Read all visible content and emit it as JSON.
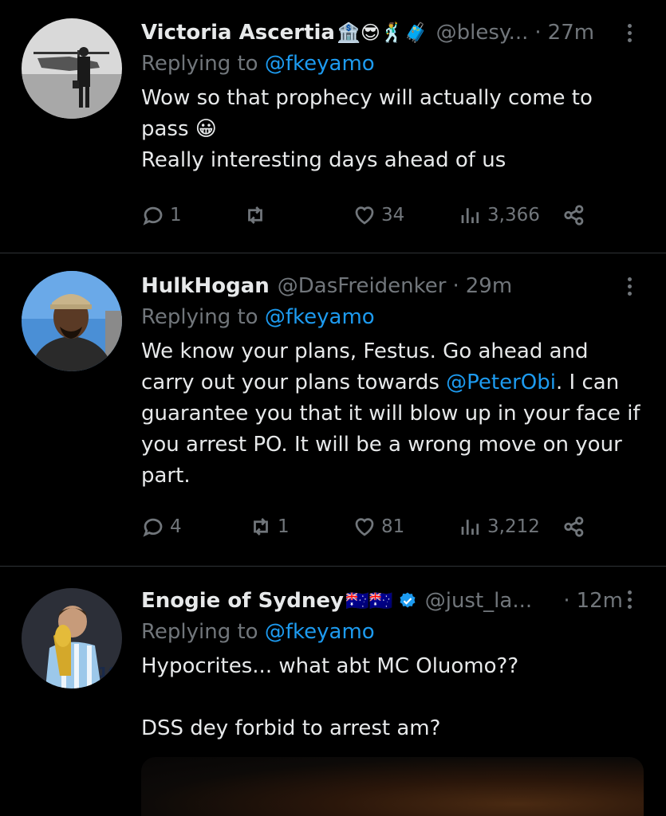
{
  "tweets": [
    {
      "name": "Victoria Ascertia",
      "emojis": "🏦😎🕺🧳",
      "handle": "@blesy...",
      "time": "27m",
      "separator": "·",
      "replying_label": "Replying to",
      "replying_to": "@fkeyamo",
      "body_lines": [
        "Wow so that prophecy will actually come to",
        "pass 😀",
        "Really interesting days ahead of us"
      ],
      "replies": "1",
      "retweets": "",
      "likes": "34",
      "views": "3,366"
    },
    {
      "name": "HulkHogan",
      "handle": "@DasFreidenker",
      "time": "29m",
      "separator": "·",
      "replying_label": "Replying to",
      "replying_to": "@fkeyamo",
      "body_line1": "We know your plans, Festus. Go ahead and",
      "body_line2_pre": "carry out your plans towards ",
      "body_line2_mention": "@PeterObi",
      "body_line2_post": ". I can",
      "body_line3": "guarantee you that it will blow up in your face if",
      "body_line4": "you arrest PO. It will be a wrong move on your",
      "body_line5": "part.",
      "replies": "4",
      "retweets": "1",
      "likes": "81",
      "views": "3,212"
    },
    {
      "name": "Enogie of Sydney",
      "emojis": "🇦🇺🇦🇺",
      "handle": "@just_la...",
      "time": "12m",
      "separator": "·",
      "replying_label": "Replying to",
      "replying_to": "@fkeyamo",
      "body_lines": [
        "Hypocrites... what abt MC Oluomo??",
        "",
        "DSS dey forbid to arrest am?"
      ]
    }
  ],
  "colors": {
    "background": "#000000",
    "text": "#e7e9ea",
    "muted": "#71767b",
    "accent": "#1d9bf0",
    "divider": "#2f3336"
  },
  "icons": [
    "reply-icon",
    "retweet-icon",
    "like-icon",
    "views-icon",
    "share-icon",
    "more-icon",
    "verified-badge-icon"
  ]
}
